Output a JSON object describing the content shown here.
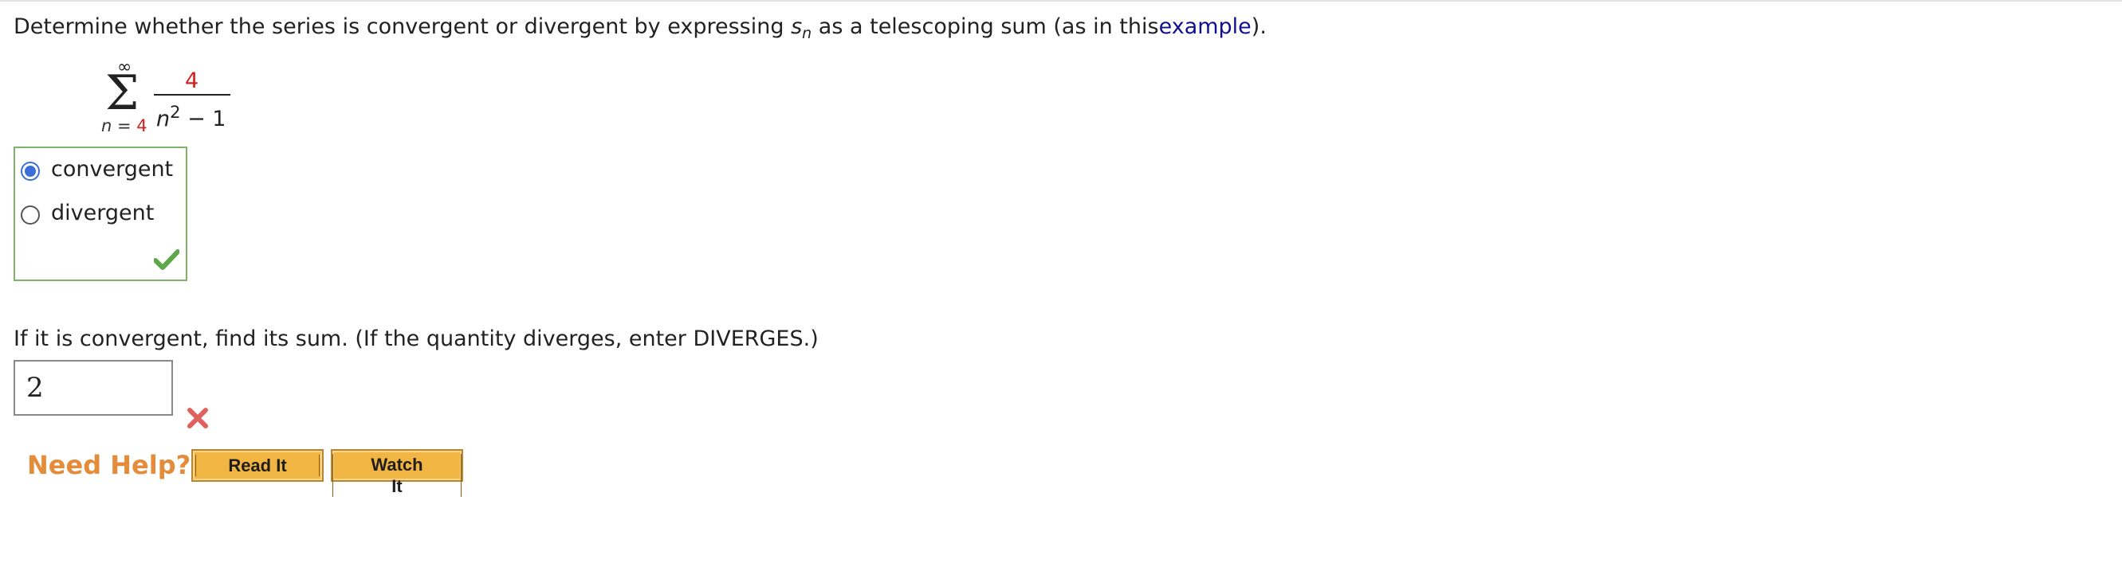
{
  "question": {
    "prefix": "Determine whether the series is convergent or divergent by expressing ",
    "sn_base": "s",
    "sn_sub": "n",
    "middle": " as a telescoping sum (as in this",
    "link_text": "example",
    "suffix": ")."
  },
  "series": {
    "upper_limit": "∞",
    "sigma": "Σ",
    "lower_var": "n",
    "lower_eq": " = ",
    "lower_value": "4",
    "numerator": "4",
    "denominator_var": "n",
    "denominator_exp": "2",
    "denominator_rest": " − 1"
  },
  "choices": [
    {
      "label": "convergent",
      "selected": true
    },
    {
      "label": "divergent",
      "selected": false
    }
  ],
  "choice_feedback": "correct",
  "sum_question": "If it is convergent, find its sum. (If the quantity diverges, enter DIVERGES.)",
  "sum_answer": {
    "value": "2",
    "feedback": "incorrect"
  },
  "help": {
    "title": "Need Help?",
    "buttons": [
      "Read It",
      "Watch It"
    ]
  },
  "colors": {
    "link": "#10108f",
    "red_value": "#d2201e",
    "correct_green": "#5fa84a",
    "incorrect_red": "#e0625e",
    "need_help_orange": "#e58c3a",
    "button_fill": "#f1b543"
  },
  "icons": {
    "correct": "check-icon",
    "incorrect": "x-icon"
  }
}
